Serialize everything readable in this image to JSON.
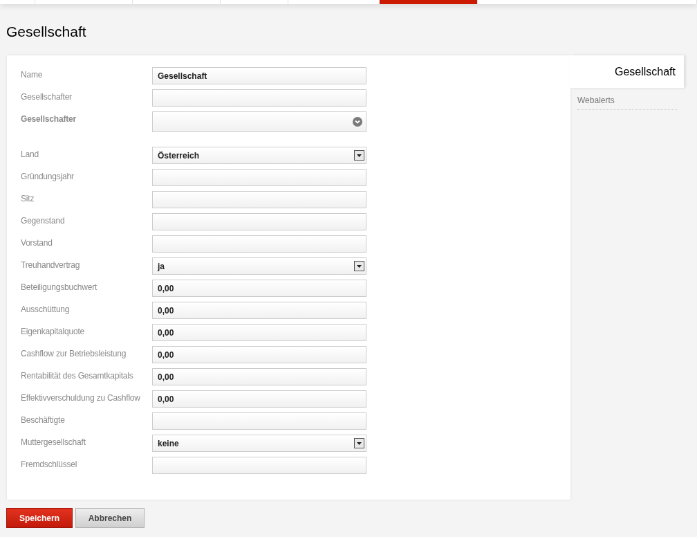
{
  "top_tabs": [
    {
      "selected": false
    },
    {
      "selected": false
    },
    {
      "selected": false
    },
    {
      "selected": false
    },
    {
      "selected": false
    },
    {
      "selected": true
    },
    {
      "selected": false
    }
  ],
  "page_title": "Gesellschaft",
  "form": {
    "fields": [
      {
        "label": "Name",
        "kind": "text",
        "value": "Gesellschaft",
        "bold_label": false
      },
      {
        "label": "Gesellschafter",
        "kind": "text",
        "bold_label": false
      },
      {
        "label": "Gesellschafter",
        "kind": "picker",
        "bold_label": true
      },
      {
        "label": "Land",
        "kind": "select",
        "value": "Österreich",
        "bold_label": false
      },
      {
        "label": "Gründungsjahr",
        "kind": "text",
        "bold_label": false
      },
      {
        "label": "Sitz",
        "kind": "text",
        "bold_label": false
      },
      {
        "label": "Gegenstand",
        "kind": "text",
        "bold_label": false
      },
      {
        "label": "Vorstand",
        "kind": "text",
        "bold_label": false
      },
      {
        "label": "Treuhandvertrag",
        "kind": "select",
        "value": "ja",
        "bold_label": false
      },
      {
        "label": "Beteiligungsbuchwert",
        "kind": "text",
        "value": "0,00",
        "bold_label": false
      },
      {
        "label": "Ausschüttung",
        "kind": "text",
        "value": "0,00",
        "bold_label": false
      },
      {
        "label": "Eigenkapitalquote",
        "kind": "text",
        "value": "0,00",
        "bold_label": false
      },
      {
        "label": "Cashflow zur Betriebsleistung",
        "kind": "text",
        "value": "0,00",
        "bold_label": false
      },
      {
        "label": "Rentabilität des Gesamtkapitals",
        "kind": "text",
        "value": "0,00",
        "bold_label": false
      },
      {
        "label": "Effektivverschuldung zu Cashflow",
        "kind": "text",
        "value": "0,00",
        "bold_label": false
      },
      {
        "label": "Beschäftigte",
        "kind": "text",
        "bold_label": false
      },
      {
        "label": "Muttergesellschaft",
        "kind": "select",
        "value": "keine",
        "bold_label": false
      },
      {
        "label": "Fremdschlüssel",
        "kind": "text",
        "bold_label": false
      }
    ]
  },
  "side_tabs": [
    {
      "label": "Gesellschaft",
      "selected": true
    },
    {
      "label": "Webalerts",
      "selected": false
    }
  ],
  "buttons": [
    {
      "label": "Speichern",
      "kind": "primary"
    },
    {
      "label": "Abbrechen",
      "kind": "secondary"
    }
  ]
}
